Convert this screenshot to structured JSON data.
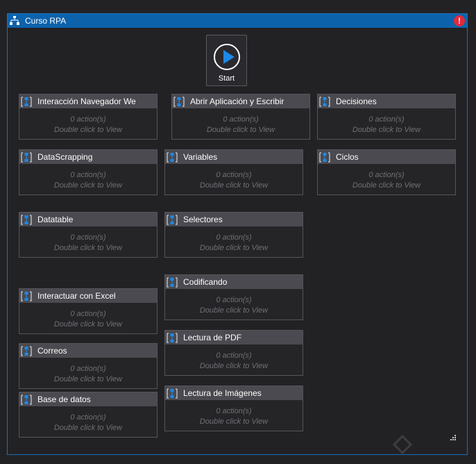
{
  "window": {
    "title": "Curso RPA"
  },
  "start": {
    "label": "Start"
  },
  "sequences": {
    "interaccion_navegador_web": {
      "name": "Interacción Navegador Web",
      "actions": "0 action(s)",
      "hint": "Double click to View"
    },
    "abrir_aplicacion": {
      "name": "Abrir Aplicación y Escribir",
      "actions": "0 action(s)",
      "hint": "Double click to View"
    },
    "decisiones": {
      "name": "Decisiones",
      "actions": "0 action(s)",
      "hint": "Double click to View"
    },
    "datascrapping": {
      "name": "DataScrapping",
      "actions": "0 action(s)",
      "hint": "Double click to View"
    },
    "variables": {
      "name": "Variables",
      "actions": "0 action(s)",
      "hint": "Double click to View"
    },
    "ciclos": {
      "name": "Ciclos",
      "actions": "0 action(s)",
      "hint": "Double click to View"
    },
    "datatable": {
      "name": "Datatable",
      "actions": "0 action(s)",
      "hint": "Double click to View"
    },
    "selectores": {
      "name": "Selectores",
      "actions": "0 action(s)",
      "hint": "Double click to View"
    },
    "codificando": {
      "name": "Codificando",
      "actions": "0 action(s)",
      "hint": "Double click to View"
    },
    "interactuar_excel": {
      "name": "Interactuar con Excel",
      "actions": "0 action(s)",
      "hint": "Double click to View"
    },
    "lectura_pdf": {
      "name": "Lectura de PDF",
      "actions": "0 action(s)",
      "hint": "Double click to View"
    },
    "correos": {
      "name": "Correos",
      "actions": "0 action(s)",
      "hint": "Double click to View"
    },
    "lectura_imagenes": {
      "name": "Lectura de Imágenes",
      "actions": "0 action(s)",
      "hint": "Double click to View"
    },
    "base_datos": {
      "name": "Base de datos",
      "actions": "0 action(s)",
      "hint": "Double click to View"
    }
  },
  "colors": {
    "accent": "#0c63ac",
    "error": "#e5293b",
    "play": "#1e88e5"
  },
  "icons": {
    "title": "flowchart-icon",
    "error": "error-icon",
    "start": "play-icon",
    "sequence": "sequence-icon",
    "grip": "resize-grip-icon"
  }
}
